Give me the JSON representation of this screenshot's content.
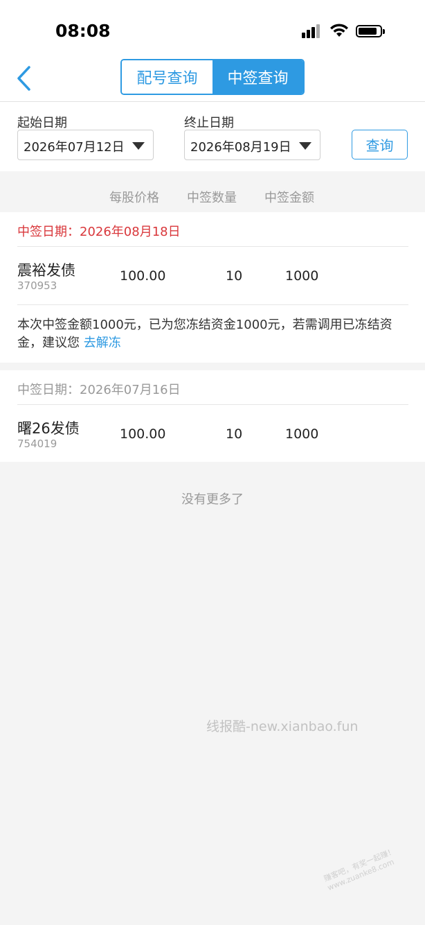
{
  "status_bar": {
    "time": "08:08"
  },
  "tabs": [
    {
      "label": "配号查询",
      "active": false
    },
    {
      "label": "中签查询",
      "active": true
    }
  ],
  "filter": {
    "start_label": "起始日期",
    "start_value": "2026年07月12日",
    "end_label": "终止日期",
    "end_value": "2026年08月19日",
    "query_label": "查询"
  },
  "columns": [
    "每股价格",
    "中签数量",
    "中签金额"
  ],
  "records": [
    {
      "date_text": "中签日期：2026年08月18日",
      "name": "震裕发债",
      "code": "370953",
      "price": "100.00",
      "quantity": "10",
      "amount": "1000",
      "note_text": "本次中签金额1000元，已为您冻结资金1000元，若需调用已冻结资金，建议您",
      "note_link": "去解冻"
    },
    {
      "date_text": "中签日期：2026年07月16日",
      "name": "曙26发债",
      "code": "754019",
      "price": "100.00",
      "quantity": "10",
      "amount": "1000"
    }
  ],
  "no_more_text": "没有更多了",
  "watermark_text": "线报酷-new.xianbao.fun",
  "corner_watermark": [
    "赚客吧，有奖一起赚！",
    "www.zuanke8.com"
  ],
  "colors": {
    "accent": "#2e9ae2",
    "alert_red": "#d9373b",
    "muted_gray": "#999999",
    "background": "#f4f4f4"
  },
  "icons": {
    "back": "chevron-left-icon",
    "signal": "cellular-signal-icon",
    "wifi": "wifi-icon",
    "battery": "battery-icon",
    "dropdown": "caret-down-icon"
  },
  "battery_level": 0.85
}
